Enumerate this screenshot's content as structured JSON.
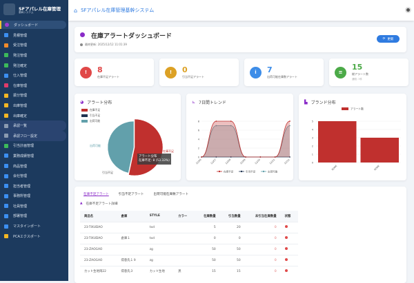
{
  "sidebar": {
    "title": "SFアパレル在庫管理",
    "subtitle": "基幹システム",
    "items": [
      {
        "label": "ダッシュボード",
        "color": "#a03ad0"
      },
      {
        "label": "見積管理",
        "color": "#3c8ef0"
      },
      {
        "label": "受注管理",
        "color": "#f08a2a"
      },
      {
        "label": "発注管理",
        "color": "#3cba5a"
      },
      {
        "label": "発注確定",
        "color": "#3cba5a"
      },
      {
        "label": "仕入管理",
        "color": "#3c8ef0"
      },
      {
        "label": "在庫管理",
        "color": "#e03a6a"
      },
      {
        "label": "振分管理",
        "color": "#f2b624"
      },
      {
        "label": "出庫管理",
        "color": "#f2b624"
      },
      {
        "label": "出庫確定",
        "color": "#f2b624"
      },
      {
        "label": "承認一覧",
        "color": "#8a9ab0"
      },
      {
        "label": "承認フロー設定",
        "color": "#8a9ab0"
      },
      {
        "label": "引当計画管理",
        "color": "#3cba5a"
      },
      {
        "label": "業務成績管理",
        "color": "#3c8ef0"
      },
      {
        "label": "商品管理",
        "color": "#3c8ef0"
      },
      {
        "label": "会社管理",
        "color": "#3c8ef0"
      },
      {
        "label": "担当者管理",
        "color": "#3c8ef0"
      },
      {
        "label": "事務所管理",
        "color": "#3c8ef0"
      },
      {
        "label": "社員管理",
        "color": "#3c8ef0"
      },
      {
        "label": "部署管理",
        "color": "#3c8ef0"
      },
      {
        "label": "マスタインポート",
        "color": "#3c8ef0"
      },
      {
        "label": "PCAエクスポート",
        "color": "#f2b624"
      }
    ]
  },
  "header": {
    "title": "SFアパレル在庫管理基幹システム"
  },
  "page": {
    "title": "在庫アラートダッシュボード",
    "updated": "最終更新: 2025/12/12 11:01:39",
    "refresh": "更新"
  },
  "stats": [
    {
      "value": "8",
      "label": "在庫不足アラート",
      "color": "#e04848",
      "icon": "!"
    },
    {
      "value": "0",
      "label": "引当不足アラート",
      "color": "#dca125",
      "icon": "!"
    },
    {
      "value": "7",
      "label": "出荷可能在庫数アラート",
      "color": "#3d8de8",
      "icon": "i"
    },
    {
      "value": "15",
      "label": "総アラート数",
      "sub": "通知: 3件",
      "color": "#4caa48",
      "icon": "≡"
    }
  ],
  "pie": {
    "title": "アラート分布",
    "legend": [
      "在庫不足",
      "引当不足",
      "出荷可能"
    ],
    "values": [
      8,
      0,
      7
    ],
    "colors": [
      "#c0302e",
      "#1f3350",
      "#62a0ab"
    ],
    "tooltip_title": "アラート分布",
    "tooltip": "在庫不足: 8 (53.33%)"
  },
  "chart_data": [
    {
      "type": "line",
      "title": "7日間トレンド",
      "categories": [
        "12/06",
        "12/07",
        "12/08",
        "12/09",
        "12/10",
        "12/11",
        "12/12"
      ],
      "series": [
        {
          "name": "在庫不足",
          "values": [
            0,
            8,
            8,
            0,
            0,
            0,
            8
          ],
          "color": "#c0302e"
        },
        {
          "name": "引当不足",
          "values": [
            0,
            0,
            0,
            0,
            0,
            0,
            0
          ],
          "color": "#1f3350"
        },
        {
          "name": "出荷可能",
          "values": [
            0,
            7,
            7,
            0,
            0,
            0,
            7
          ],
          "color": "#62a0ab"
        }
      ],
      "yticks": [
        "0",
        "2",
        "4",
        "6",
        "8"
      ],
      "ylim": [
        0,
        8
      ]
    },
    {
      "type": "bar",
      "title": "ブランド分布",
      "legend": "アラート数",
      "categories": [
        "NONE",
        "NONE"
      ],
      "values": [
        5,
        3
      ],
      "yticks": [
        "0",
        "1",
        "2",
        "3",
        "4",
        "5"
      ],
      "ylim": [
        0,
        5
      ]
    }
  ],
  "tabs": [
    "在庫不足アラート",
    "引当不足アラート",
    "出荷可能在庫数アラート"
  ],
  "table": {
    "title": "在庫不足アラート詳細",
    "headers": [
      "商品名",
      "倉庫",
      "STYLE",
      "カラー",
      "在庫数量",
      "引当数量",
      "未引当在庫数量",
      "状態"
    ],
    "rows": [
      [
        "23-TIXUDAO",
        "",
        "txd",
        "",
        "5",
        "20",
        "0"
      ],
      [
        "23-TIXUDAO",
        "倉庫１",
        "txd",
        "",
        "0",
        "0",
        "0"
      ],
      [
        "23-ZAOGAO",
        "",
        "zg",
        "",
        "50",
        "50",
        "0"
      ],
      [
        "23-ZAOGAO",
        "得意先１９",
        "zg",
        "",
        "50",
        "50",
        "0"
      ],
      [
        "カット生地岡22",
        "得意先３",
        "カット生地",
        "黒",
        "15",
        "15",
        "0"
      ]
    ]
  }
}
